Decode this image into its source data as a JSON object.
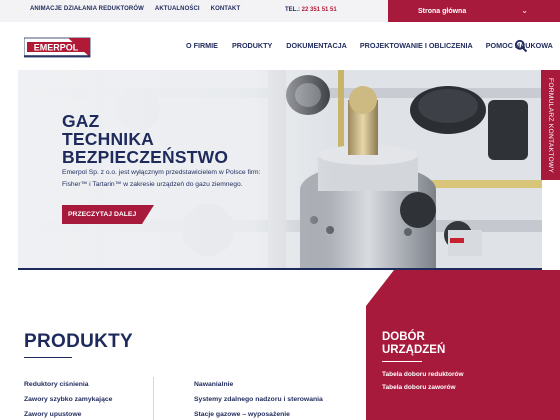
{
  "topbar": {
    "links": [
      "ANIMACJE DZIAŁANIA REDUKTORÓW",
      "AKTUALNOŚCI",
      "KONTAKT"
    ],
    "phone_label": "TEL.:",
    "phone_number": "22 351 51 51",
    "home_label": "Strona główna"
  },
  "header": {
    "logo_text": "EMERPOL",
    "nav": [
      "O FIRMIE",
      "PRODUKTY",
      "DOKUMENTACJA",
      "PROJEKTOWANIE I OBLICZENIA",
      "POMOC NAUKOWA"
    ],
    "search_icon": "search-icon"
  },
  "hero": {
    "title_lines": [
      "GAZ",
      "TECHNIKA",
      "BEZPIECZEŃSTWO"
    ],
    "text": "Emerpol Sp. z o.o. jest wyłącznym przedstawicielem w Polsce firm: Fisher™ i Tartarin™ w zakresie urządzeń do gazu ziemnego.",
    "button": "PRZECZYTAJ DALEJ"
  },
  "side_tab": "FORMULARZ KONTAKTOWY",
  "products": {
    "title": "PRODUKTY",
    "col1": [
      "Reduktory ciśnienia",
      "Zawory szybko zamykające",
      "Zawory upustowe"
    ],
    "col2": [
      "Nawanialnie",
      "Systemy zdalnego nadzoru i sterowania",
      "Stacje gazowe – wyposażenie"
    ]
  },
  "selection": {
    "title_lines": [
      "DOBÓR",
      "URZĄDZEŃ"
    ],
    "links": [
      "Tabela doboru reduktorów",
      "Tabela doboru zaworów"
    ]
  },
  "colors": {
    "navy": "#1f2a5c",
    "crimson": "#a81a3c",
    "light_gray": "#f3f3f5"
  }
}
